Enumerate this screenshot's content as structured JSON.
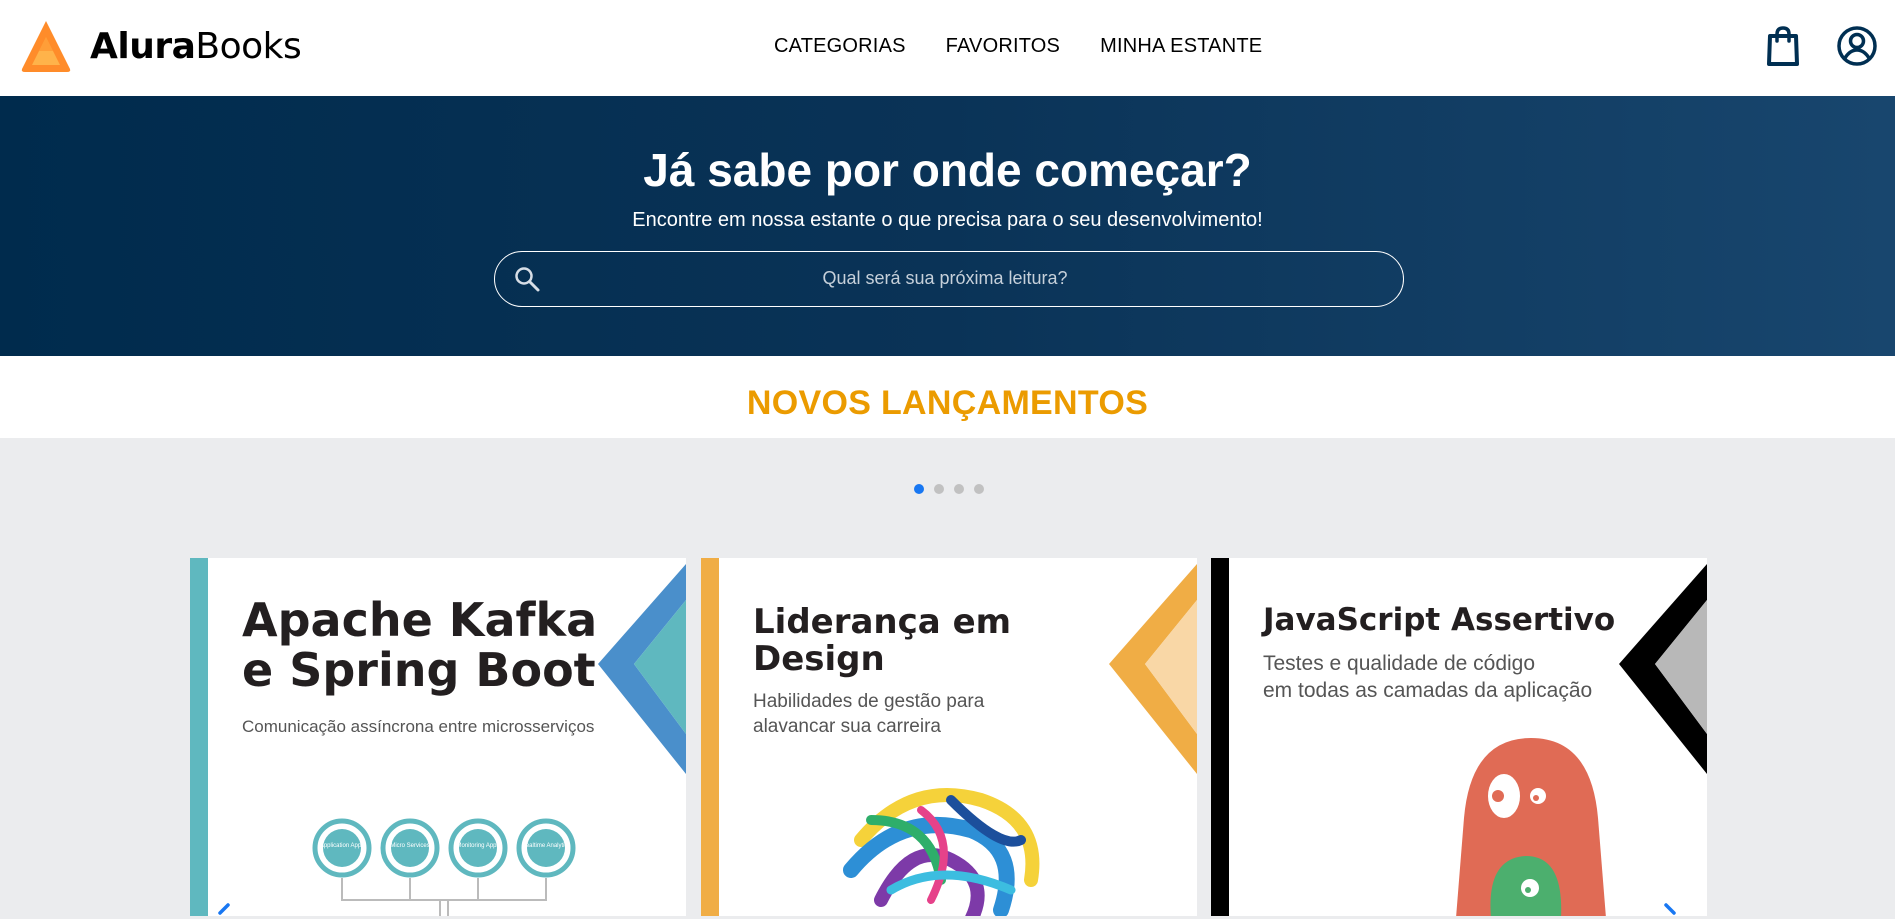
{
  "header": {
    "logo": {
      "brand_bold": "Alura",
      "brand_regular": "Books",
      "colors": [
        "#ff8c2a",
        "#ffa735"
      ]
    },
    "nav": [
      {
        "label": "CATEGORIAS"
      },
      {
        "label": "FAVORITOS"
      },
      {
        "label": "MINHA ESTANTE"
      }
    ],
    "icons": [
      "shopping-bag-icon",
      "user-account-icon"
    ]
  },
  "hero": {
    "title": "Já sabe por onde começar?",
    "subtitle": "Encontre em nossa estante o que precisa para o seu desenvolvimento!",
    "search": {
      "placeholder": "Qual será sua próxima leitura?",
      "value": ""
    }
  },
  "section": {
    "title": "NOVOS LANÇAMENTOS",
    "color": "#eb9b00"
  },
  "carousel": {
    "dot_count": 4,
    "active_index": 0,
    "books": [
      {
        "title_line1": "Apache Kafka",
        "title_line2": "e Spring Boot",
        "subtitle_line1": "Comunicação assíncrona entre microsserviços",
        "subtitle_line2": "",
        "accent": "#5fb8bf",
        "accent2": "#4a8fcb",
        "diagram_labels": [
          "Application Apps",
          "Micro Services",
          "Monitoring Apps",
          "Realtime Analytics"
        ]
      },
      {
        "title_line1": "Liderança em",
        "title_line2": "Design",
        "subtitle_line1": "Habilidades de gestão para",
        "subtitle_line2": "alavancar sua carreira",
        "accent": "#f0ad45",
        "accent2": "#f6cfa0"
      },
      {
        "title_line1": "JavaScript Assertivo",
        "title_line2": "",
        "subtitle_line1": "Testes e qualidade de código",
        "subtitle_line2": "em todas as camadas da aplicação",
        "accent": "#000000",
        "accent2": "#b8b8b8"
      }
    ]
  }
}
